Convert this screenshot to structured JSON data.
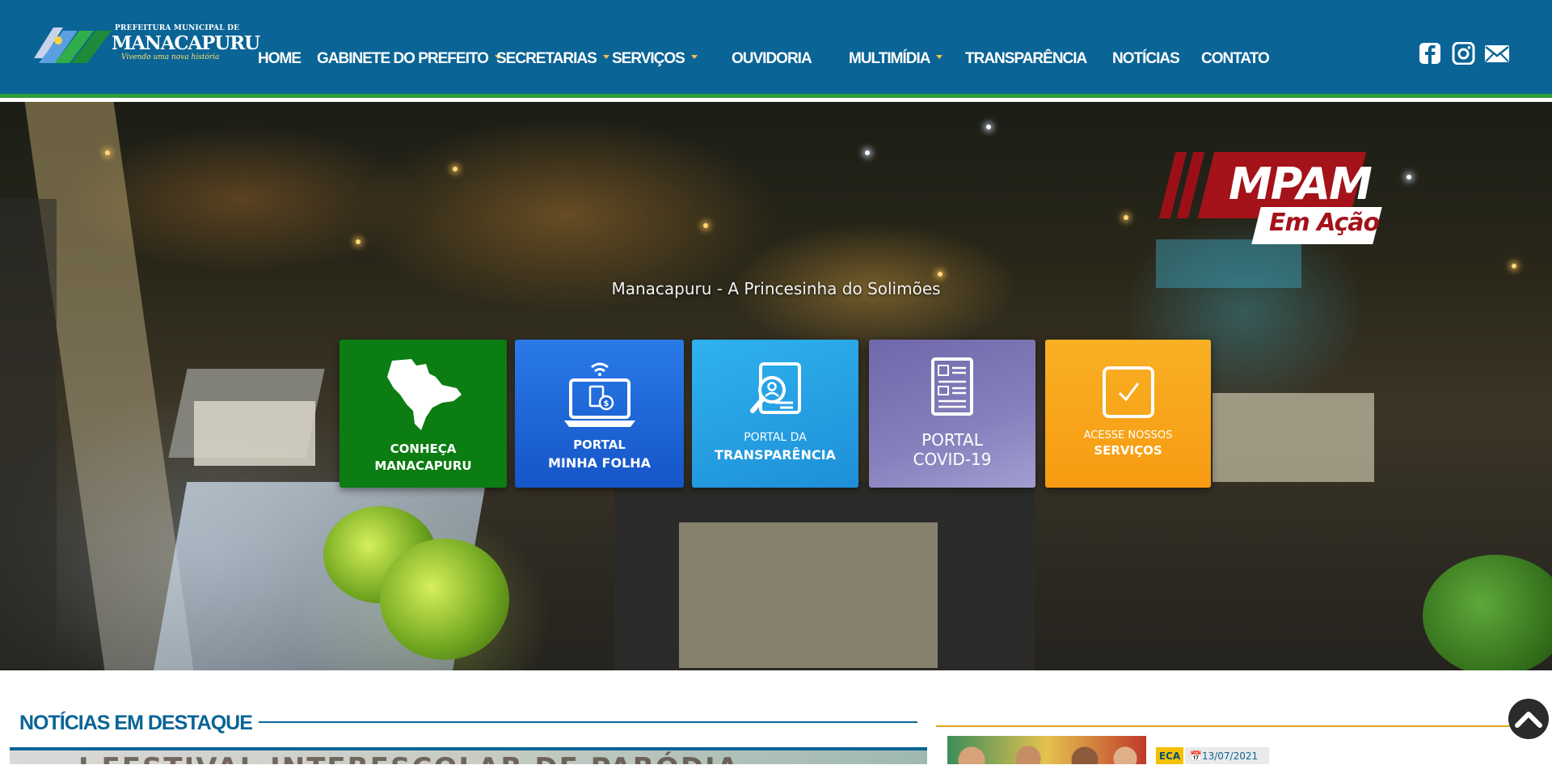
{
  "header": {
    "logo": {
      "line1": "PREFEITURA MUNICIPAL DE",
      "line2": "MANACAPURU",
      "slogan": "Vivendo uma nova história"
    },
    "nav": [
      {
        "label": "HOME",
        "has_dropdown": false
      },
      {
        "label": "GABINETE DO PREFEITO",
        "has_dropdown": true
      },
      {
        "label": "SECRETARIAS",
        "has_dropdown": true
      },
      {
        "label": "SERVIÇOS",
        "has_dropdown": true
      },
      {
        "label": "OUVIDORIA",
        "has_dropdown": false
      },
      {
        "label": "MULTIMÍDIA",
        "has_dropdown": true
      },
      {
        "label": "TRANSPARÊNCIA",
        "has_dropdown": false
      },
      {
        "label": "NOTÍCIAS",
        "has_dropdown": false
      },
      {
        "label": "CONTATO",
        "has_dropdown": false
      }
    ],
    "social": [
      "facebook-icon",
      "instagram-icon",
      "email-icon"
    ],
    "colors": {
      "bar": "#0a6496",
      "accent_line": "#2e9c3b",
      "caret": "#f2c14a"
    }
  },
  "hero": {
    "badge": {
      "line1": "MPAM",
      "line2": "Em Ação"
    },
    "tagline": "Manacapuru - A Princesinha do Solimões",
    "tiles": [
      {
        "line1": "CONHEÇA",
        "line2": "MANACAPURU",
        "icon": "map-icon",
        "color": "#0b7d12"
      },
      {
        "line1": "PORTAL",
        "line2": "MINHA FOLHA",
        "icon": "laptop-money-icon",
        "color": "#1863d8"
      },
      {
        "line1": "PORTAL DA",
        "line2": "TRANSPARÊNCIA",
        "icon": "document-search-icon",
        "color": "#2aa6e8"
      },
      {
        "line1": "PORTAL",
        "line2": "COVID-19",
        "icon": "newspaper-icon",
        "color": "#7b74b3"
      },
      {
        "line1": "ACESSE NOSSOS",
        "line2": "SERVIÇOS",
        "icon": "checkbox-icon",
        "color": "#f7a71a"
      }
    ]
  },
  "news": {
    "title": "NOTÍCIAS EM DESTAQUE",
    "featured_image_text": "I FESTIVAL INTERESCOLAR DE PARÓDIA",
    "side": {
      "category": "ECA",
      "date": "13/07/2021"
    }
  }
}
